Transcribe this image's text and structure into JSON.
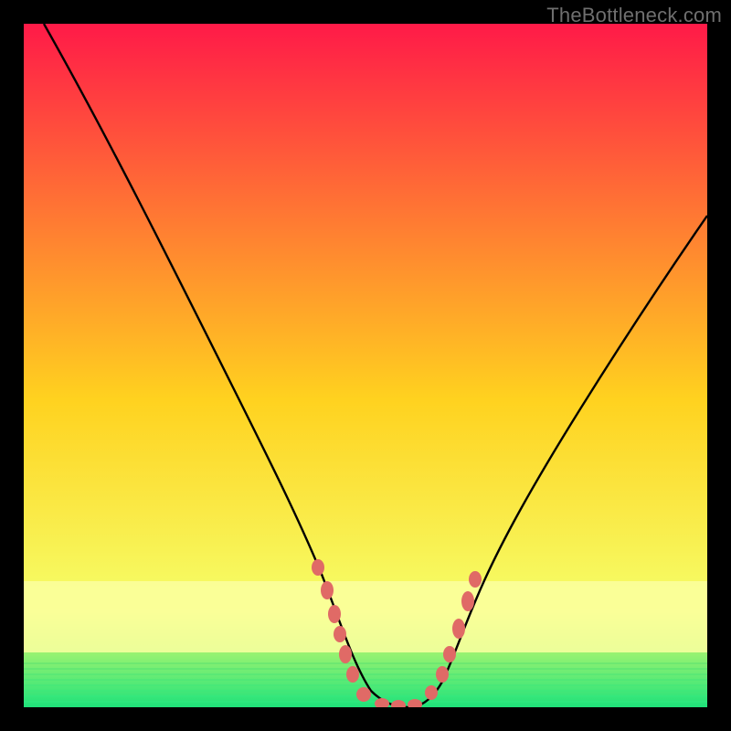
{
  "watermark": "TheBottleneck.com",
  "colors": {
    "frame": "#000000",
    "grad_top": "#ff1a48",
    "grad_mid": "#ffd21f",
    "grad_low": "#f5ff6a",
    "grad_bottom": "#1fe27a",
    "curve": "#000000",
    "dots": "#e06a66",
    "pale_band": "#faffa0",
    "watermark_color": "#6f6f6f"
  },
  "chart_data": {
    "type": "line",
    "title": "",
    "xlabel": "",
    "ylabel": "",
    "xlim": [
      0,
      100
    ],
    "ylim": [
      0,
      100
    ],
    "curve": {
      "x": [
        3,
        8,
        13,
        18,
        23,
        28,
        33,
        37,
        40,
        43,
        46,
        48,
        50,
        52,
        54,
        56,
        58,
        60,
        62,
        65,
        70,
        76,
        82,
        88,
        94,
        100
      ],
      "y": [
        100,
        90,
        80,
        70,
        60,
        50,
        40,
        32,
        25,
        18,
        11,
        6,
        3,
        1,
        0,
        0,
        1,
        3,
        5,
        9,
        16,
        25,
        35,
        44,
        53,
        62
      ],
      "note": "Values approximated from rendered pixels; x is horizontal percent across gradient area, y is vertical percent from bottom (0) to top (100)."
    },
    "dot_clusters": {
      "left": {
        "x_range": [
          42,
          48
        ],
        "y_range": [
          2,
          22
        ],
        "count": 7
      },
      "right": {
        "x_range": [
          60,
          64
        ],
        "y_range": [
          3,
          22
        ],
        "count": 5
      }
    }
  }
}
